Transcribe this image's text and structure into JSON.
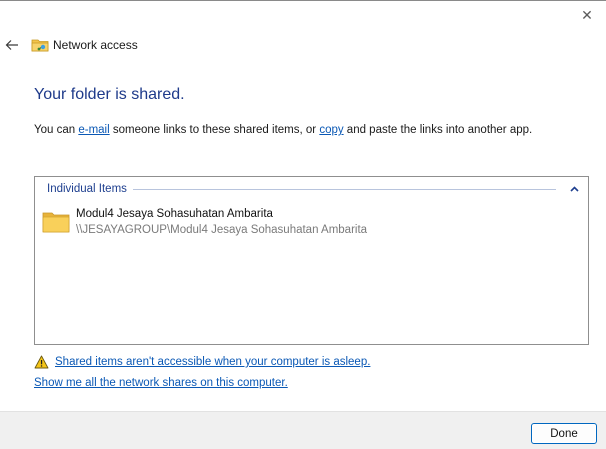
{
  "window": {
    "title": "Network access",
    "close_glyph": "✕",
    "icons": {
      "back": "back-arrow-icon",
      "title": "network-folder-icon",
      "close": "close-icon"
    }
  },
  "main": {
    "heading": "Your folder is shared.",
    "intro": {
      "before_email": "You can ",
      "email_link": "e-mail",
      "middle": " someone links to these shared items, or ",
      "copy_link": "copy",
      "after_copy": " and paste the links into another app."
    }
  },
  "items_panel": {
    "group_label": "Individual Items",
    "items": [
      {
        "name": "Modul4 Jesaya Sohasuhatan Ambarita",
        "path": "\\\\JESAYAGROUP\\Modul4 Jesaya Sohasuhatan Ambarita",
        "icon": "folder-icon"
      }
    ]
  },
  "links": {
    "asleep_warning": "Shared items aren't accessible when your computer is asleep.",
    "show_shares": "Show me all the network shares on this computer."
  },
  "footer": {
    "done_label": "Done"
  },
  "colors": {
    "heading": "#1e3a8a",
    "link": "#0a58b5",
    "group_label": "#1e3f8f",
    "button_border": "#0067c0",
    "footer_bg": "#f0f0f0",
    "folder": "#f7c64a",
    "warning": "#f5c518"
  }
}
